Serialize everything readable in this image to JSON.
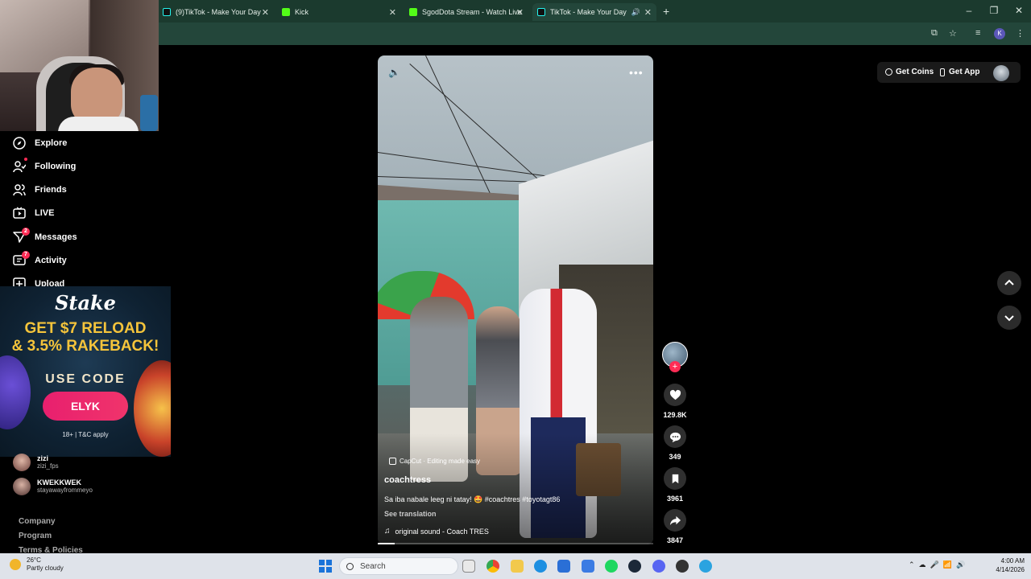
{
  "browser": {
    "tabs": [
      {
        "title": "(9)TikTok - Make Your Day",
        "icon": "tiktok-icon"
      },
      {
        "title": "Kick",
        "icon": "kick-icon"
      },
      {
        "title": "SgodDota Stream - Watch Live",
        "icon": "kick-icon"
      },
      {
        "title": "TikTok - Make Your Day",
        "icon": "tiktok-icon",
        "active": true
      }
    ],
    "profile_initial": "K"
  },
  "nav": {
    "items": [
      {
        "label": "Explore",
        "icon": "compass-icon"
      },
      {
        "label": "Following",
        "icon": "following-icon"
      },
      {
        "label": "Friends",
        "icon": "friends-icon"
      },
      {
        "label": "LIVE",
        "icon": "live-icon"
      },
      {
        "label": "Messages",
        "icon": "messages-icon",
        "badge": "2"
      },
      {
        "label": "Activity",
        "icon": "activity-icon",
        "badge": "7"
      },
      {
        "label": "Upload",
        "icon": "upload-icon"
      }
    ]
  },
  "ad": {
    "brand": "Stake",
    "headline_1": "GET $7 RELOAD",
    "headline_2": "& 3.5% RAKEBACK!",
    "use_code": "USE CODE",
    "code": "ELYK",
    "legal": "18+ | T&C apply"
  },
  "following_accounts": [
    {
      "name": "zizi",
      "handle": "zizi_fps"
    },
    {
      "name": "KWEKKWEK",
      "handle": "stayawayfrommeyo"
    }
  ],
  "footer_links": [
    "Company",
    "Program",
    "Terms & Policies"
  ],
  "topbar": {
    "get_coins": "Get Coins",
    "get_app": "Get App"
  },
  "video": {
    "capcut_label": "CapCut · Editing made easy",
    "author": "coachtress",
    "caption": "Sa iba nabale leeg ni tatay! 🤩 #coachtres #toyotagt86",
    "see_translation": "See translation",
    "sound": "original sound - Coach TRES",
    "progress": 0.06
  },
  "actions": {
    "likes": "129.8K",
    "comments": "349",
    "saves": "3961",
    "shares": "3847"
  },
  "taskbar": {
    "temperature": "26°C",
    "weather": "Partly cloudy",
    "search_placeholder": "Search",
    "time": "4:00 AM",
    "date": "4/14/2026"
  },
  "colors": {
    "tab_bar": "#1b3a2e",
    "tiktok_red": "#fe2c55",
    "stake_gold": "#f5c43b"
  }
}
